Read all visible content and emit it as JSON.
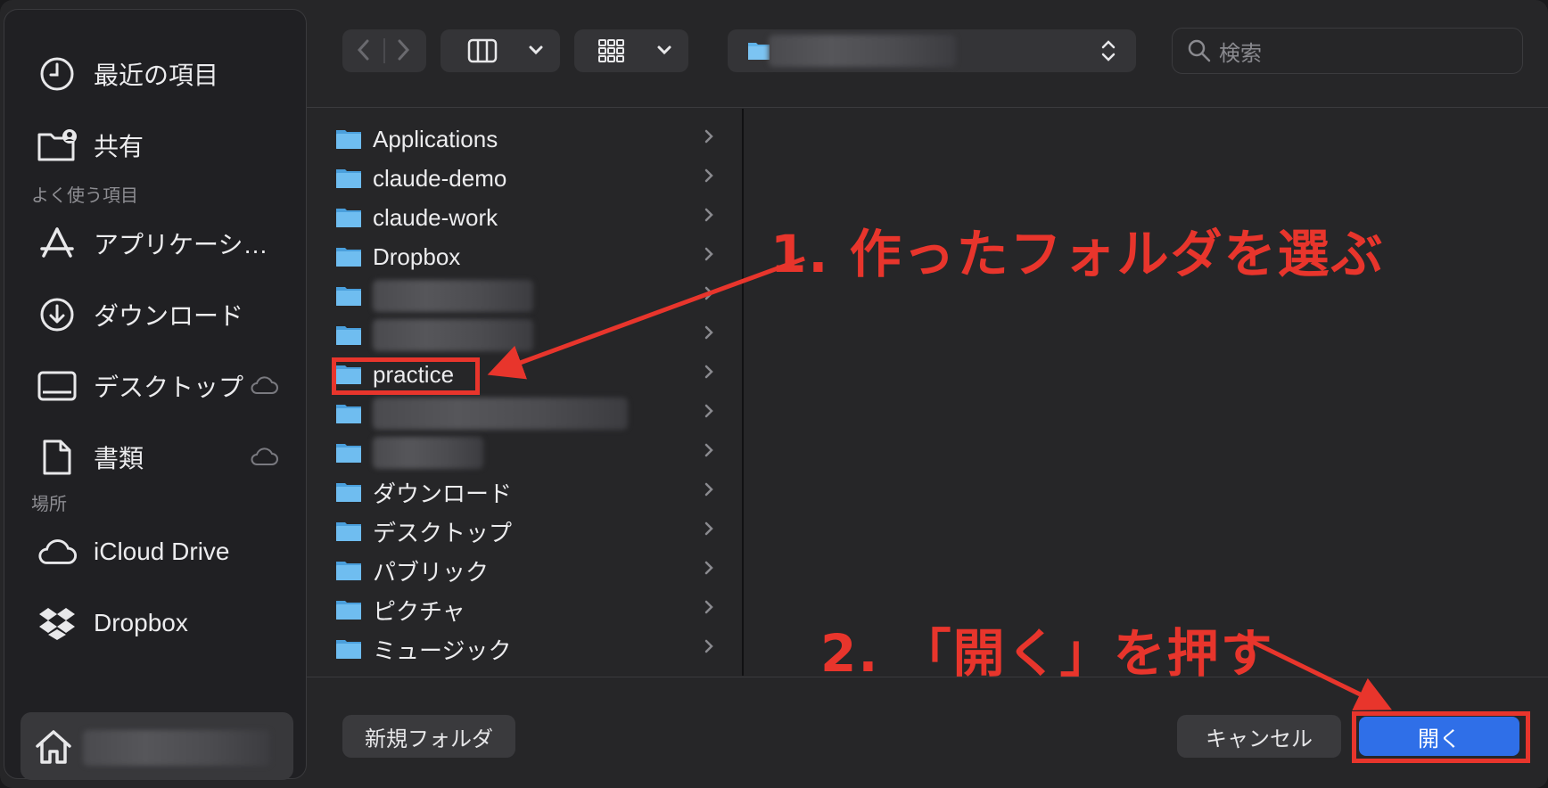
{
  "sidebar": {
    "recent_label": "最近の項目",
    "shared_label": "共有",
    "favorites_heading": "よく使う項目",
    "applications_label": "アプリケーシ…",
    "downloads_label": "ダウンロード",
    "desktop_label": "デスクトップ",
    "documents_label": "書類",
    "locations_heading": "場所",
    "icloud_label": "iCloud Drive",
    "dropbox_label": "Dropbox"
  },
  "toolbar": {
    "search_placeholder": "検索"
  },
  "files": [
    {
      "name": "Applications",
      "icon": "apps-folder-icon"
    },
    {
      "name": "claude-demo",
      "icon": "folder-icon"
    },
    {
      "name": "claude-work",
      "icon": "folder-icon"
    },
    {
      "name": "Dropbox",
      "icon": "dropbox-folder-icon"
    },
    {
      "name": "",
      "icon": "folder-icon"
    },
    {
      "name": "",
      "icon": "folder-icon"
    },
    {
      "name": "practice",
      "icon": "folder-icon"
    },
    {
      "name": "",
      "icon": "folder-icon"
    },
    {
      "name": "",
      "icon": "folder-icon"
    },
    {
      "name": "ダウンロード",
      "icon": "downloads-folder-icon"
    },
    {
      "name": "デスクトップ",
      "icon": "desktop-folder-icon"
    },
    {
      "name": "パブリック",
      "icon": "public-folder-icon"
    },
    {
      "name": "ピクチャ",
      "icon": "pictures-folder-icon"
    },
    {
      "name": "ミュージック",
      "icon": "music-folder-icon"
    }
  ],
  "footer": {
    "new_folder_label": "新規フォルダ",
    "cancel_label": "キャンセル",
    "open_label": "開く"
  },
  "annotations": {
    "step1": "1. 作ったフォルダを選ぶ",
    "step2": "2. 「開く」を押す"
  },
  "colors": {
    "accent": "#2f6fe8",
    "annotation": "#e8352c",
    "folder": "#5fb3ea"
  }
}
